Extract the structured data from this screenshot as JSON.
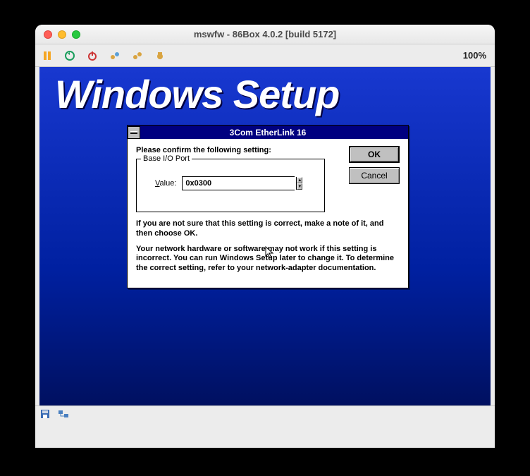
{
  "macTitle": "mswfw - 86Box 4.0.2 [build 5172]",
  "zoom": "100%",
  "setupHeader": "Windows Setup",
  "dialog": {
    "title": "3Com EtherLink 16",
    "prompt": "Please confirm the following setting:",
    "groupLegend": "Base I/O Port",
    "valueLabelPrefix": "V",
    "valueLabelRest": "alue:",
    "value": "0x0300",
    "okLabel": "OK",
    "cancelLabel": "Cancel",
    "info1": "If you are not sure that this setting is correct, make a note of it, and then choose OK.",
    "info2": "Your network hardware or software may not work if this setting is incorrect. You can run Windows Setup later to change it. To determine the correct setting, refer to your network-adapter documentation."
  }
}
